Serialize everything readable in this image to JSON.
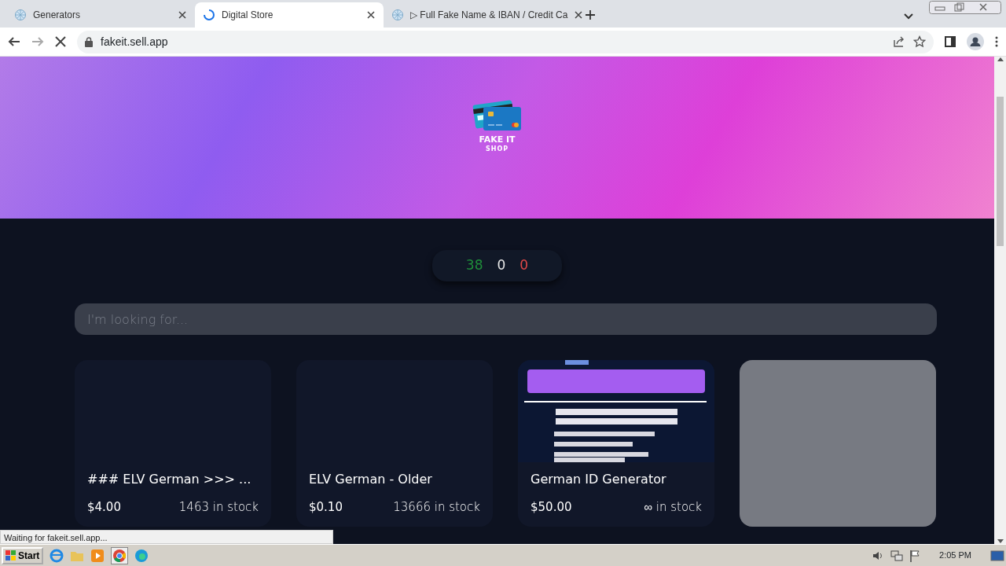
{
  "browser": {
    "tabs": [
      {
        "title": "Generators",
        "selected": false,
        "loading": false
      },
      {
        "title": "Digital Store",
        "selected": true,
        "loading": true
      },
      {
        "title": "▷ Full Fake Name & IBAN / Credit Ca",
        "selected": false,
        "loading": false
      }
    ],
    "url": "fakeit.sell.app",
    "status_text": "Waiting for fakeit.sell.app..."
  },
  "shop": {
    "logo_title": "FAKE IT",
    "logo_subtitle": "SHOP",
    "counters": [
      {
        "value": "38",
        "color": "#1f8f3a"
      },
      {
        "value": "0",
        "color": "#e8e8e8"
      },
      {
        "value": "0",
        "color": "#e04848"
      }
    ],
    "search": {
      "placeholder": "I'm looking for..."
    },
    "products": [
      {
        "kind": "none",
        "name": "### ELV German >>> ...",
        "price": "$4.00",
        "stock": "1463 in stock"
      },
      {
        "kind": "none",
        "name": "ELV German - Older",
        "price": "$0.10",
        "stock": "13666 in stock"
      },
      {
        "kind": "picture",
        "name": "German ID Generator",
        "price": "$50.00",
        "stock": "∞ in stock"
      },
      {
        "kind": "loading"
      }
    ]
  },
  "taskbar": {
    "start": "Start",
    "clock": "2:05 PM"
  }
}
